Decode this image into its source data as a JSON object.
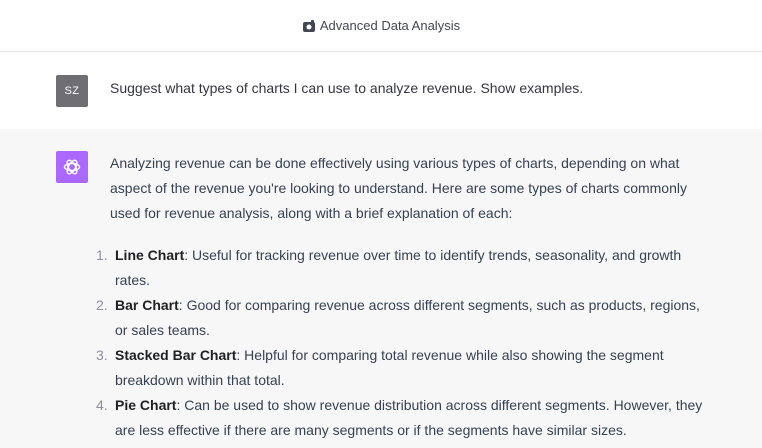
{
  "header": {
    "title": "Advanced Data Analysis",
    "icon": "data-analysis-icon"
  },
  "user_message": {
    "avatar_initials": "SZ",
    "text": "Suggest what types of charts I can use to analyze revenue. Show examples."
  },
  "assistant_message": {
    "avatar_icon": "openai-logo-icon",
    "avatar_color": "#ab68ff",
    "intro": "Analyzing revenue can be done effectively using various types of charts, depending on what aspect of the revenue you're looking to understand. Here are some types of charts commonly used for revenue analysis, along with a brief explanation of each:",
    "items": [
      {
        "number": "1.",
        "title": "Line Chart",
        "desc": ": Useful for tracking revenue over time to identify trends, seasonality, and growth rates."
      },
      {
        "number": "2.",
        "title": "Bar Chart",
        "desc": ": Good for comparing revenue across different segments, such as products, regions, or sales teams."
      },
      {
        "number": "3.",
        "title": "Stacked Bar Chart",
        "desc": ": Helpful for comparing total revenue while also showing the segment breakdown within that total."
      },
      {
        "number": "4.",
        "title": "Pie Chart",
        "desc": ": Can be used to show revenue distribution across different segments. However, they are less effective if there are many segments or if the segments have similar sizes."
      }
    ]
  }
}
